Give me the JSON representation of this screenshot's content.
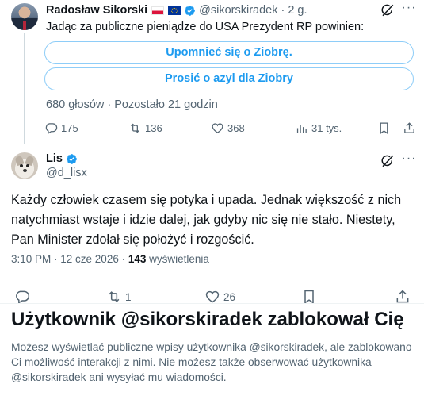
{
  "post1": {
    "author_name": "Radosław Sikorski",
    "flags": [
      "flag-poland",
      "flag-eu"
    ],
    "handle": "@sikorskiradek",
    "separator": "·",
    "time": "2 g.",
    "text": "Jadąc za publiczne pieniądze do USA Prezydent RP powinien:",
    "poll": {
      "options": [
        "Upomnieć się o Ziobrę.",
        "Prosić o azyl dla Ziobry"
      ],
      "meta": "680 głosów · Pozostało 21 godzin"
    },
    "actions": {
      "replies": "175",
      "reposts": "136",
      "likes": "368",
      "views": "31 tys."
    }
  },
  "post2": {
    "author_name": "Lis",
    "handle": "@d_lisx",
    "text": "Każdy człowiek czasem się potyka i upada. Jednak większość z nich natychmiast wstaje i idzie dalej, jak gdyby nic się nie stało. Niestety, Pan Minister zdołał się położyć i rozgościć.",
    "timestamp": "3:10 PM · 12 cze 2026 · ",
    "views_count": "143",
    "views_label": " wyświetlenia",
    "actions": {
      "reposts": "1",
      "likes": "26"
    }
  },
  "blocked_notice": {
    "title": "Użytkownik @sikorskiradek zablokował Cię",
    "description": "Możesz wyświetlać publiczne wpisy użytkownika @sikorskiradek, ale zablokowano Ci możliwość interakcji z nimi. Nie możesz także obserwować użytkownika @sikorskiradek ani wysyłać mu wiadomości."
  },
  "colors": {
    "accent": "#1d9bf0",
    "secondary_text": "#536471",
    "primary_text": "#0f1419"
  }
}
